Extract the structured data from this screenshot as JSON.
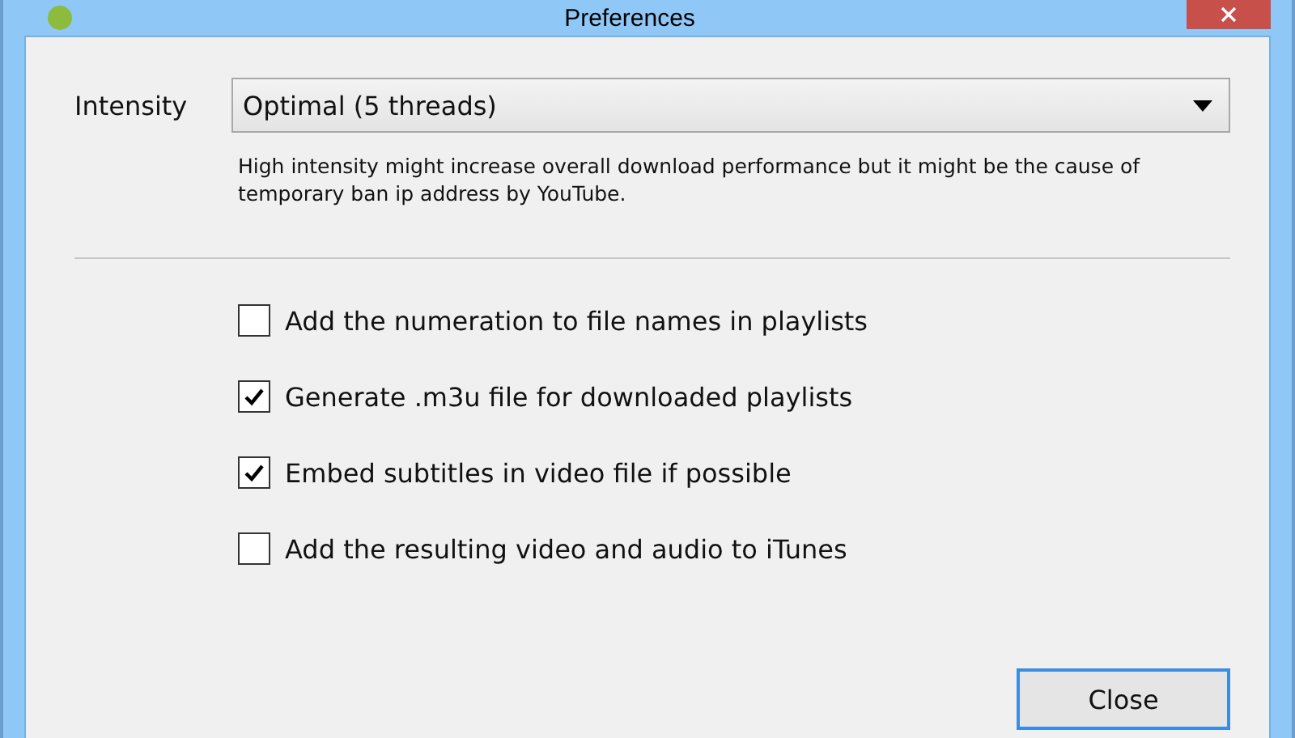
{
  "window": {
    "title": "Preferences"
  },
  "intensity": {
    "label": "Intensity",
    "value": "Optimal (5 threads)",
    "help": "High intensity might increase overall download performance but it might be the cause of temporary ban ip address by YouTube."
  },
  "options": [
    {
      "label": "Add the numeration to file names in playlists",
      "checked": false
    },
    {
      "label": "Generate .m3u file for downloaded playlists",
      "checked": true
    },
    {
      "label": "Embed subtitles in video file if possible",
      "checked": true
    },
    {
      "label": "Add the resulting video and audio to iTunes",
      "checked": false
    }
  ],
  "buttons": [
    {
      "label": "Close",
      "focused": true
    }
  ]
}
